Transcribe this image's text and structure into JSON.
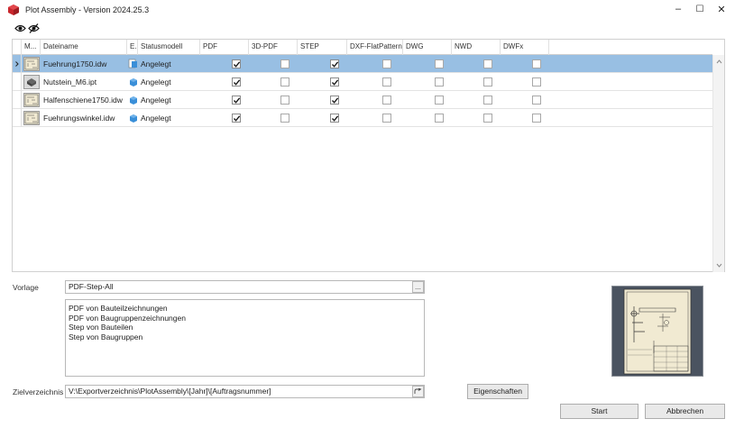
{
  "window": {
    "title": "Plot Assembly - Version 2024.25.3",
    "minimize_glyph": "–",
    "maximize_glyph": "☐",
    "close_glyph": "✕"
  },
  "toolbar": {
    "show_icon": "eye-icon",
    "hide_icon": "eye-off-icon"
  },
  "grid": {
    "columns": [
      "M...",
      "Dateiname",
      "E...",
      "Statusmodell",
      "PDF",
      "3D-PDF",
      "STEP",
      "DXF-FlatPattern",
      "DWG",
      "NWD",
      "DWFx"
    ],
    "rows": [
      {
        "file": "Fuehrung1750.idw",
        "status": "Angelegt",
        "pdf": true,
        "pdf3d": false,
        "step": true,
        "dxf": false,
        "dwg": false,
        "nwd": false,
        "dwfx": false,
        "selected": true,
        "kind": "drawing"
      },
      {
        "file": "Nutstein_M6.ipt",
        "status": "Angelegt",
        "pdf": true,
        "pdf3d": false,
        "step": true,
        "dxf": false,
        "dwg": false,
        "nwd": false,
        "dwfx": false,
        "selected": false,
        "kind": "part"
      },
      {
        "file": "Halfenschiene1750.idw",
        "status": "Angelegt",
        "pdf": true,
        "pdf3d": false,
        "step": true,
        "dxf": false,
        "dwg": false,
        "nwd": false,
        "dwfx": false,
        "selected": false,
        "kind": "drawing"
      },
      {
        "file": "Fuehrungswinkel.idw",
        "status": "Angelegt",
        "pdf": true,
        "pdf3d": false,
        "step": true,
        "dxf": false,
        "dwg": false,
        "nwd": false,
        "dwfx": false,
        "selected": false,
        "kind": "drawing"
      }
    ]
  },
  "vorlage": {
    "label": "Vorlage",
    "value": "PDF-Step-All",
    "browse": "..."
  },
  "template_lines": [
    "PDF von Bauteilzeichnungen",
    "PDF von Baugruppenzeichnungen",
    "Step von Bauteilen",
    "Step von Baugruppen"
  ],
  "zielverzeichnis": {
    "label": "Zielverzeichnis",
    "value": "V:\\Exportverzeichnis\\PlotAssembly\\[Jahr]\\[Auftragsnummer]"
  },
  "buttons": {
    "eigenschaften": "Eigenschaften",
    "start": "Start",
    "abbrechen": "Abbrechen"
  },
  "colors": {
    "selection": "#98bfe3",
    "app_icon": "#c8262c"
  }
}
